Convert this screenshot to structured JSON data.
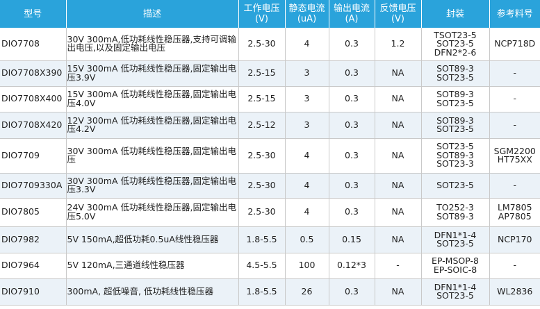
{
  "headers": [
    {
      "line1": "型号",
      "line2": ""
    },
    {
      "line1": "描述",
      "line2": ""
    },
    {
      "line1": "工作电压",
      "line2": "(V)"
    },
    {
      "line1": "静态电流",
      "line2": "(uA)"
    },
    {
      "line1": "输出电流",
      "line2": "(A)"
    },
    {
      "line1": "反馈电压",
      "line2": "(V)"
    },
    {
      "line1": "封装",
      "line2": ""
    },
    {
      "line1": "参考料号",
      "line2": ""
    }
  ],
  "rows": [
    {
      "model": "DIO7708",
      "desc": "30V 300mA,低功耗线性稳压器,支持可调输出电压,以及固定输出电压",
      "voltage": "2.5-30",
      "iq": "4",
      "iout": "0.3",
      "vfb": "1.2",
      "pkg": [
        "TSOT23-5",
        "SOT23-5",
        "DFN2*2-6"
      ],
      "ref": [
        "NCP718D"
      ]
    },
    {
      "model": "DIO7708X390",
      "desc": "15V 300mA 低功耗线性稳压器,固定输出电压3.9V",
      "voltage": "2.5-15",
      "iq": "3",
      "iout": "0.3",
      "vfb": "NA",
      "pkg": [
        "SOT89-3",
        "SOT23-5"
      ],
      "ref": [
        "-"
      ]
    },
    {
      "model": "DIO7708X400",
      "desc": "15V 300mA 低功耗线性稳压器,固定输出电压4.0V",
      "voltage": "2.5-15",
      "iq": "3",
      "iout": "0.3",
      "vfb": "NA",
      "pkg": [
        "SOT89-3",
        "SOT23-5"
      ],
      "ref": [
        "-"
      ]
    },
    {
      "model": "DIO7708X420",
      "desc": "12V 300mA 低功耗线性稳压器,固定输出电压4.2V",
      "voltage": "2.5-12",
      "iq": "3",
      "iout": "0.3",
      "vfb": "NA",
      "pkg": [
        "SOT89-3",
        "SOT23-5"
      ],
      "ref": [
        "-"
      ]
    },
    {
      "model": "DIO7709",
      "desc": "30V 300mA 低功耗线性稳压器,固定输出电压",
      "voltage": "2.5-30",
      "iq": "4",
      "iout": "0.3",
      "vfb": "NA",
      "pkg": [
        "SOT23-5",
        "SOT89-3",
        "SOT23-3"
      ],
      "ref": [
        "SGM2200",
        "HT75XX"
      ]
    },
    {
      "model": "DIO7709330A",
      "desc": "30V 300mA 低功耗线性稳压器,固定输出电压3.3V",
      "voltage": "2.5-30",
      "iq": "4",
      "iout": "0.3",
      "vfb": "NA",
      "pkg": [
        "SOT23-5"
      ],
      "ref": [
        "-"
      ]
    },
    {
      "model": "DIO7805",
      "desc": "24V 300mA 低功耗线性稳压器,固定输出电压5.0V",
      "voltage": "2.5-30",
      "iq": "4",
      "iout": "0.3",
      "vfb": "NA",
      "pkg": [
        "TO252-3",
        "SOT89-3"
      ],
      "ref": [
        "LM7805",
        "AP7805"
      ]
    },
    {
      "model": "DIO7982",
      "desc": "5V 150mA,超低功耗0.5uA线性稳压器",
      "voltage": "1.8-5.5",
      "iq": "0.5",
      "iout": "0.15",
      "vfb": "NA",
      "pkg": [
        "DFN1*1-4",
        "SOT23-5"
      ],
      "ref": [
        "NCP170"
      ]
    },
    {
      "model": "DIO7964",
      "desc": "5V 120mA,三通道线性稳压器",
      "voltage": "4.5-5.5",
      "iq": "100",
      "iout": "0.12*3",
      "vfb": "-",
      "pkg": [
        "EP-MSOP-8",
        "EP-SOIC-8"
      ],
      "ref": [
        "-"
      ]
    },
    {
      "model": "DIO7910",
      "desc": "300mA, 超低噪音, 低功耗线性稳压器",
      "voltage": "1.8-5.5",
      "iq": "26",
      "iout": "0.3",
      "vfb": "NA",
      "pkg": [
        "DFN1*1-4",
        "SOT23-5"
      ],
      "ref": [
        "WL2836"
      ]
    }
  ]
}
